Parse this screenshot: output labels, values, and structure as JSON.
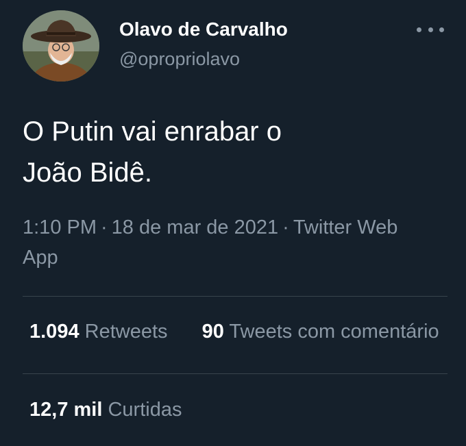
{
  "author": {
    "display_name": "Olavo de Carvalho",
    "handle": "@opropriolavo"
  },
  "tweet": {
    "text_line1": "O Putin vai enrabar o",
    "text_line2": "João Bidê.",
    "time": "1:10 PM",
    "date": "18 de mar de 2021",
    "source": "Twitter Web App"
  },
  "stats": {
    "retweets_count": "1.094",
    "retweets_label": "Retweets",
    "quotes_count": "90",
    "quotes_label": "Tweets com comentário",
    "likes_count": "12,7 mil",
    "likes_label": "Curtidas"
  },
  "icons": {
    "more": "more-options-icon"
  },
  "colors": {
    "background": "#15202b",
    "primary_text": "#ffffff",
    "secondary_text": "#8b98a5",
    "divider": "#38444d"
  }
}
